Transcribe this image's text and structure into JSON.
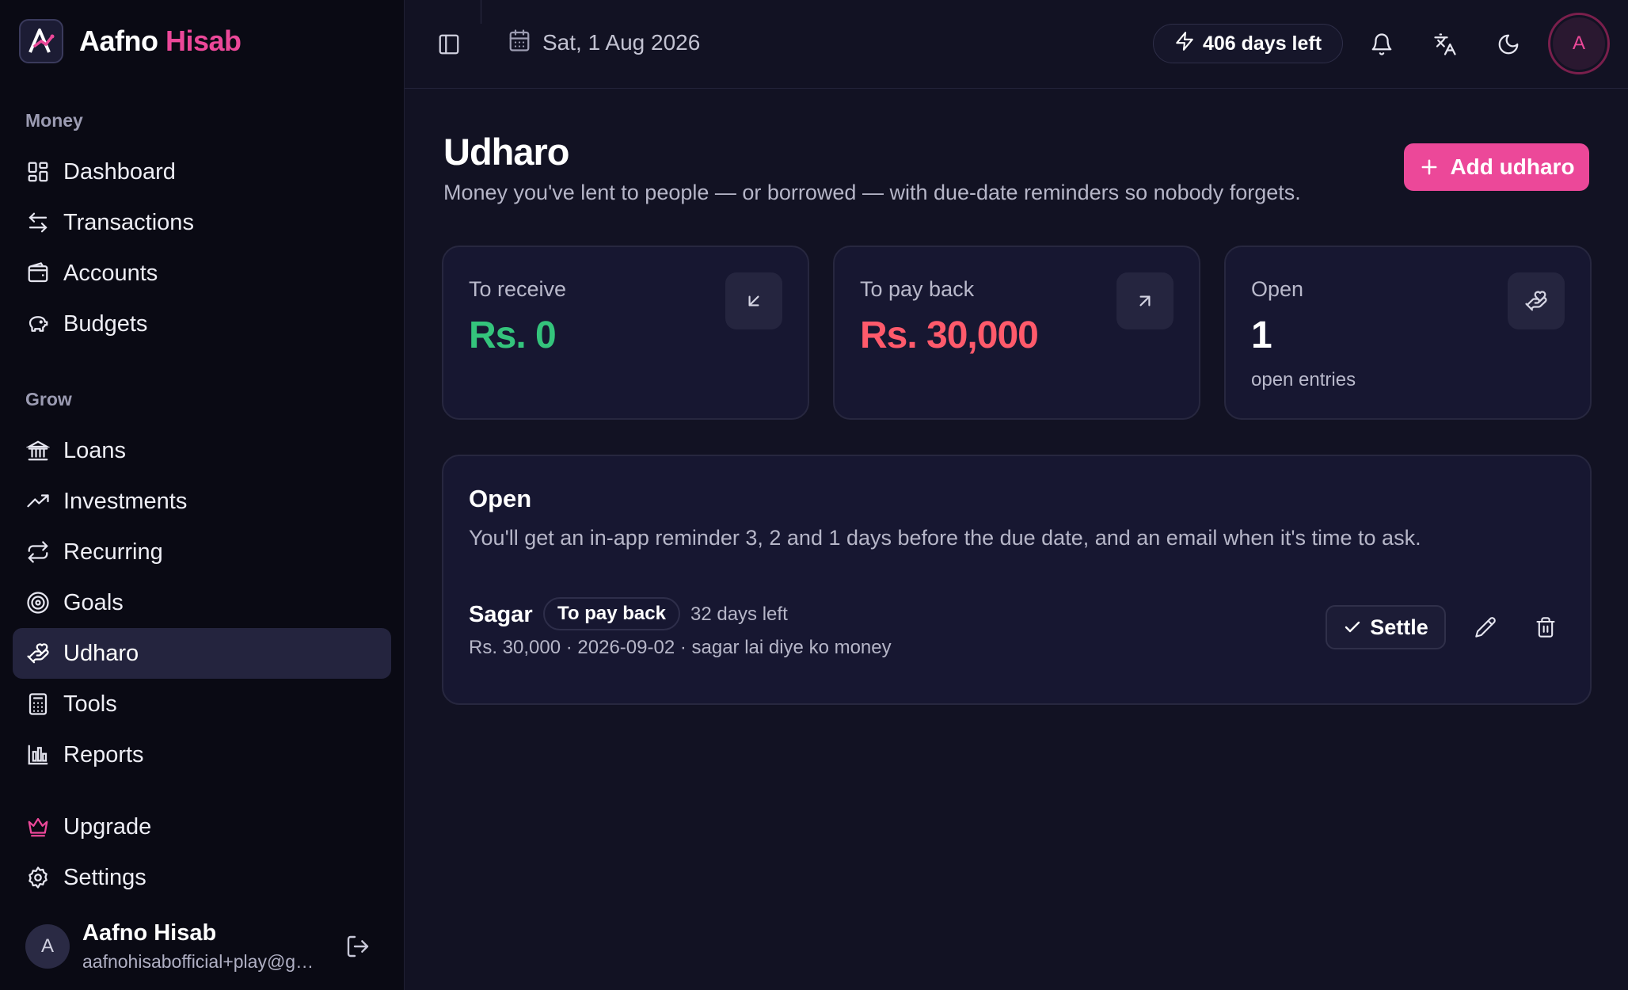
{
  "brand": {
    "name_part1": "Aafno",
    "name_part2": "Hisab"
  },
  "sidebar": {
    "sections": [
      {
        "label": "Money"
      },
      {
        "label": "Grow"
      }
    ],
    "items": [
      {
        "label": "Dashboard",
        "icon": "dashboard-icon"
      },
      {
        "label": "Transactions",
        "icon": "transactions-icon"
      },
      {
        "label": "Accounts",
        "icon": "wallet-icon"
      },
      {
        "label": "Budgets",
        "icon": "piggy-bank-icon"
      },
      {
        "label": "Loans",
        "icon": "bank-icon"
      },
      {
        "label": "Investments",
        "icon": "trending-up-icon"
      },
      {
        "label": "Recurring",
        "icon": "repeat-icon"
      },
      {
        "label": "Goals",
        "icon": "target-icon"
      },
      {
        "label": "Udharo",
        "icon": "handshake-icon",
        "active": true
      },
      {
        "label": "Tools",
        "icon": "calculator-icon"
      },
      {
        "label": "Reports",
        "icon": "bar-chart-icon"
      },
      {
        "label": "Upgrade",
        "icon": "crown-icon"
      },
      {
        "label": "Settings",
        "icon": "gear-icon"
      }
    ],
    "user": {
      "initial": "A",
      "name": "Aafno Hisab",
      "email": "aafnohisabofficial+play@gmail.com"
    }
  },
  "topbar": {
    "date": "Sat, 1 Aug 2026",
    "days_left": "406 days left",
    "avatar_initial": "A"
  },
  "page": {
    "title": "Udharo",
    "subtitle": "Money you've lent to people — or borrowed — with due-date reminders so nobody forgets.",
    "add_button": "Add udharo"
  },
  "stats": [
    {
      "label": "To receive",
      "value": "Rs. 0",
      "color": "#34c47c"
    },
    {
      "label": "To pay back",
      "value": "Rs. 30,000",
      "color": "#ff5a6b"
    },
    {
      "label": "Open",
      "value": "1",
      "extra": "open entries"
    }
  ],
  "open_section": {
    "title": "Open",
    "description": "You'll get an in-app reminder 3, 2 and 1 days before the due date, and an email when it's time to ask.",
    "entries": [
      {
        "name": "Sagar",
        "badge": "To pay back",
        "days_left": "32 days left",
        "meta": "Rs. 30,000 · 2026-09-02 · sagar lai diye ko money",
        "settle_label": "Settle"
      }
    ]
  },
  "colors": {
    "accent": "#ec4899",
    "green": "#34c47c",
    "red": "#ff5a6b",
    "background": "#121223",
    "sidebar": "#0a0a14"
  }
}
